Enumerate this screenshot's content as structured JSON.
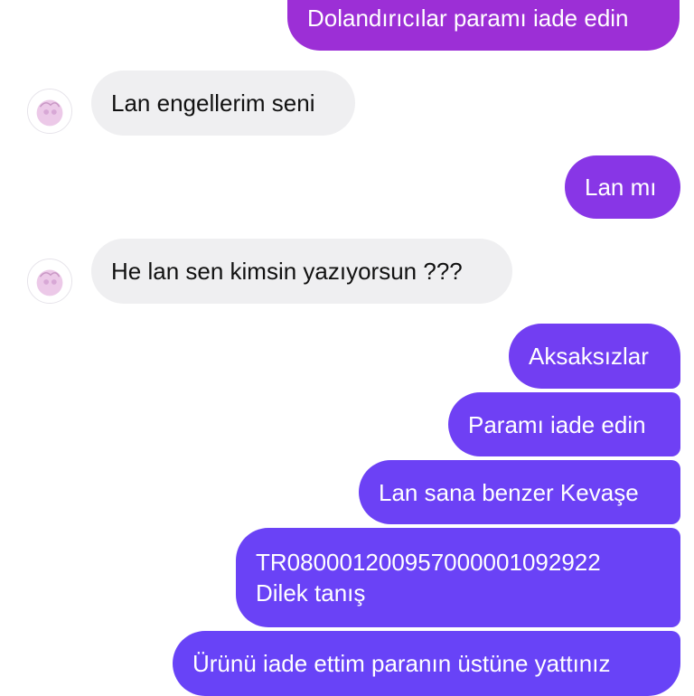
{
  "colors": {
    "outgoing_top": "#9a2fd8",
    "outgoing_mid": "#7a3af0",
    "outgoing_bottom": "#6a40f6",
    "incoming_bg": "#efeff1",
    "incoming_text": "#111111",
    "avatar_tint": "#e7c4e4"
  },
  "messages": [
    {
      "direction": "outgoing",
      "text": "Dolandırıcılar paramı iade edin"
    },
    {
      "direction": "incoming",
      "text": "Lan engellerim seni",
      "avatar": "contact-avatar-icon"
    },
    {
      "direction": "outgoing",
      "text": "Lan mı"
    },
    {
      "direction": "incoming",
      "text": "He lan sen kimsin yazıyorsun ???",
      "avatar": "contact-avatar-icon"
    },
    {
      "direction": "outgoing",
      "text": "Aksaksızlar"
    },
    {
      "direction": "outgoing",
      "text": "Paramı iade edin"
    },
    {
      "direction": "outgoing",
      "text": "Lan sana benzer Kevaşe"
    },
    {
      "direction": "outgoing",
      "lines": [
        "TR080001200957000001092922",
        "Dilek tanış"
      ]
    },
    {
      "direction": "outgoing",
      "text": "Ürünü iade ettim paranın üstüne yattınız"
    }
  ]
}
